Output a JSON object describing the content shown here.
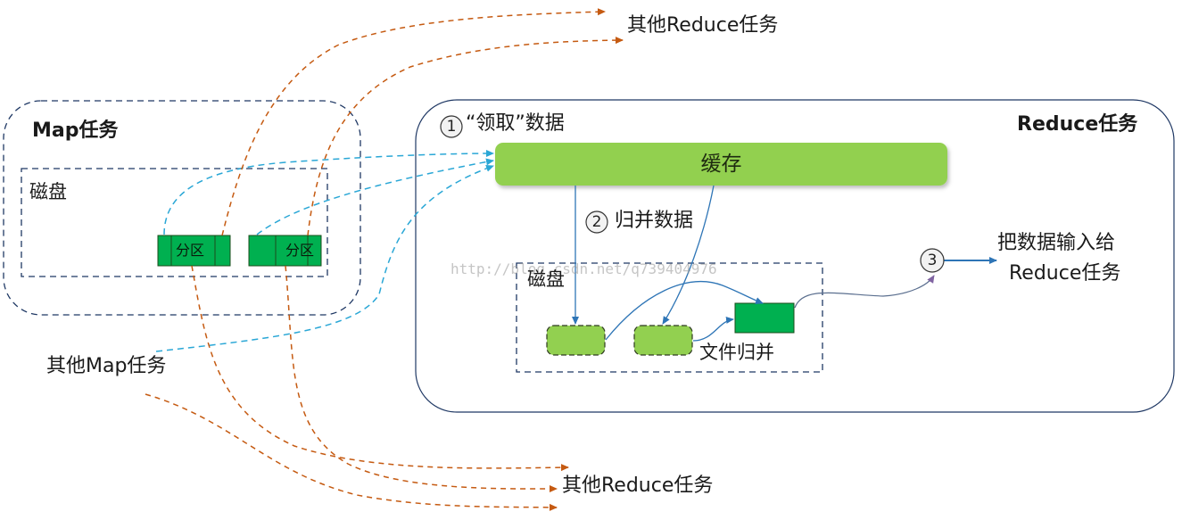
{
  "map_task": {
    "title": "Map任务",
    "disk_label": "磁盘",
    "partition_label": "分区"
  },
  "other_map_tasks": "其他Map任务",
  "reduce_task": {
    "title": "Reduce任务",
    "step1_label": "“领取”数据",
    "step2_label": "归并数据",
    "cache_label": "缓存",
    "disk_label": "磁盘",
    "file_merge_label": "文件归并"
  },
  "step_numbers": [
    "1",
    "2",
    "3"
  ],
  "output_label": {
    "line1": "把数据输入给",
    "line2": "Reduce任务"
  },
  "other_reduce_tasks": "其他Reduce任务",
  "watermark": "http://blog.csdn.net/q739404976",
  "colors": {
    "cache_fill": "#92d050",
    "partition_fill": "#00b050",
    "fetch_arrow": "#2aa7d6",
    "shuffle_arrow": "#c55a11",
    "merge_arrow": "#2e75b6",
    "box_border": "#1f3864"
  }
}
